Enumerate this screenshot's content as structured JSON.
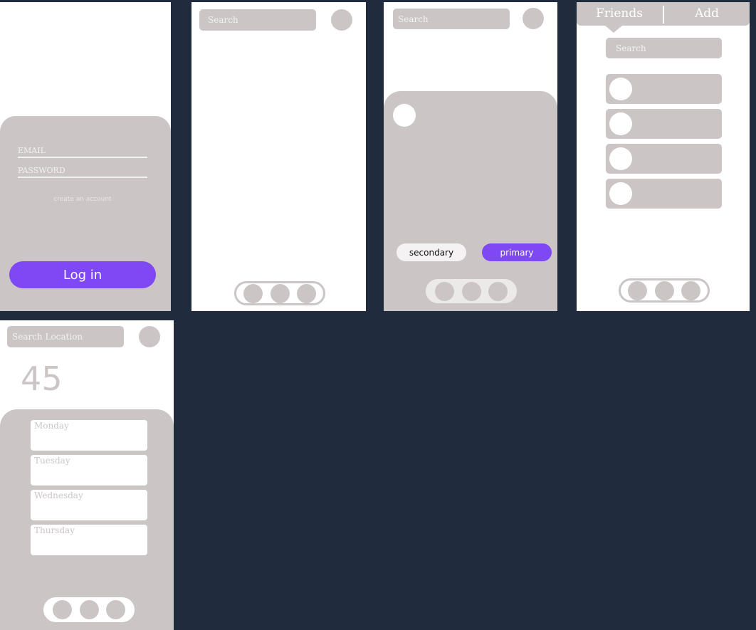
{
  "login": {
    "email_label": "EMAIL",
    "password_label": "PASSWORD",
    "create_account": "create an account",
    "login_button": "Log in"
  },
  "screen2": {
    "search_placeholder": "Search"
  },
  "screen3": {
    "search_placeholder": "Search",
    "secondary_button": "secondary",
    "primary_button": "primary"
  },
  "friends": {
    "tab_friends": "Friends",
    "tab_add": "Add",
    "search_placeholder": "Search"
  },
  "weather": {
    "search_placeholder": "Search Location",
    "temperature": "45",
    "days": [
      "Monday",
      "Tuesday",
      "Wednesday",
      "Thursday"
    ]
  },
  "colors": {
    "background": "#202b3d",
    "panel_gray": "#ccc5c5",
    "accent_purple": "#7f48f5"
  }
}
